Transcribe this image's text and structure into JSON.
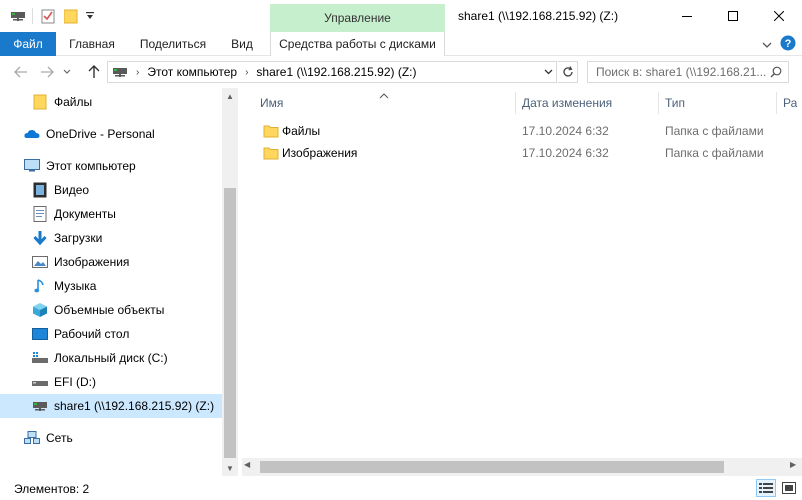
{
  "window": {
    "title": "share1 (\\\\192.168.215.92) (Z:)",
    "context_tab_header": "Управление"
  },
  "ribbon": {
    "tabs": [
      "Файл",
      "Главная",
      "Поделиться",
      "Вид",
      "Средства работы с дисками"
    ]
  },
  "address": {
    "segments": [
      "Этот компьютер",
      "share1 (\\\\192.168.215.92) (Z:)"
    ]
  },
  "search": {
    "placeholder": "Поиск в: share1 (\\\\192.168.21..."
  },
  "sidebar": {
    "items": [
      {
        "label": "Файлы",
        "icon": "folder-icon"
      },
      {
        "label": "OneDrive - Personal",
        "icon": "onedrive-icon"
      },
      {
        "label": "Этот компьютер",
        "icon": "computer-icon"
      },
      {
        "label": "Видео",
        "icon": "video-folder-icon"
      },
      {
        "label": "Документы",
        "icon": "documents-folder-icon"
      },
      {
        "label": "Загрузки",
        "icon": "downloads-folder-icon"
      },
      {
        "label": "Изображения",
        "icon": "pictures-folder-icon"
      },
      {
        "label": "Музыка",
        "icon": "music-folder-icon"
      },
      {
        "label": "Объемные объекты",
        "icon": "3d-objects-icon"
      },
      {
        "label": "Рабочий стол",
        "icon": "desktop-folder-icon"
      },
      {
        "label": "Локальный диск (C:)",
        "icon": "local-disk-icon"
      },
      {
        "label": "EFI (D:)",
        "icon": "drive-icon"
      },
      {
        "label": "share1 (\\\\192.168.215.92) (Z:)",
        "icon": "network-drive-icon",
        "selected": true
      },
      {
        "label": "Сеть",
        "icon": "network-icon"
      }
    ]
  },
  "columns": [
    "Имя",
    "Дата изменения",
    "Тип",
    "Ра"
  ],
  "files": [
    {
      "name": "Файлы",
      "modified": "17.10.2024 6:32",
      "type": "Папка с файлами"
    },
    {
      "name": "Изображения",
      "modified": "17.10.2024 6:32",
      "type": "Папка с файлами"
    }
  ],
  "status": {
    "item_count": "Элементов: 2"
  },
  "colors": {
    "file_tab": "#1979ca",
    "context_tab": "#c6efce",
    "selection": "#cce8ff",
    "folder": "#ffd75e"
  }
}
